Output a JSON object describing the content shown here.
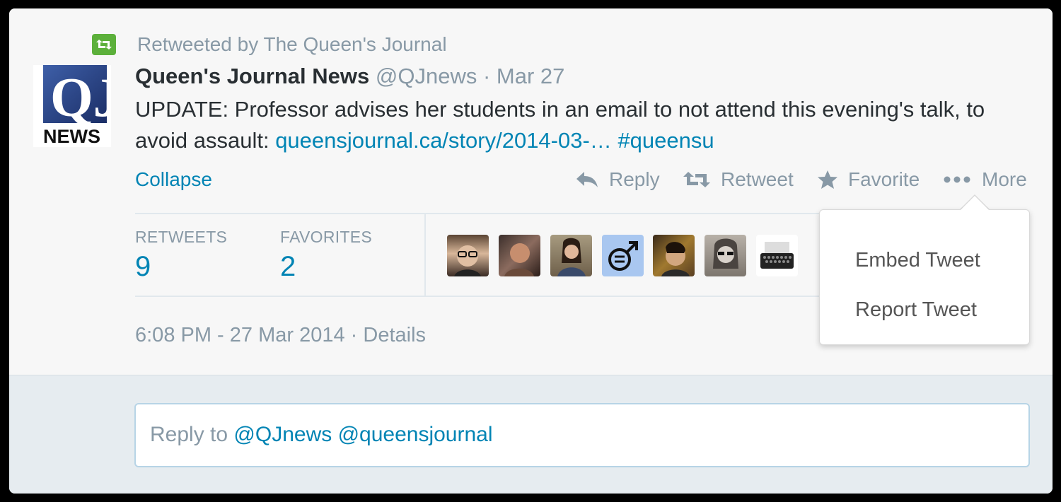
{
  "retweet_context": "Retweeted by The Queen's Journal",
  "avatar": {
    "letters": "QJ",
    "caption": "NEWS"
  },
  "tweet": {
    "fullname": "Queen's Journal News",
    "username": "@QJnews",
    "separator": "·",
    "date": "Mar 27",
    "text": "UPDATE: Professor advises her students in an email to not attend this evening's talk, to avoid assault:",
    "link": "queensjournal.ca/story/2014-03-…",
    "hashtag": "#queensu"
  },
  "collapse_label": "Collapse",
  "actions": {
    "reply": "Reply",
    "retweet": "Retweet",
    "favorite": "Favorite",
    "more": "More"
  },
  "stats": {
    "retweets_label": "RETWEETS",
    "retweets_value": "9",
    "favorites_label": "FAVORITES",
    "favorites_value": "2"
  },
  "timestamp": {
    "time": "6:08 PM - 27 Mar 2014",
    "separator": "·",
    "details": "Details"
  },
  "more_menu": {
    "embed": "Embed Tweet",
    "report": "Report Tweet"
  },
  "reply_box": {
    "prefix": "Reply to",
    "mention1": "@QJnews",
    "mention2": "@queensjournal"
  },
  "colors": {
    "link": "#0084b4",
    "muted": "#8899a6",
    "retweet_green": "#5cb03b"
  }
}
